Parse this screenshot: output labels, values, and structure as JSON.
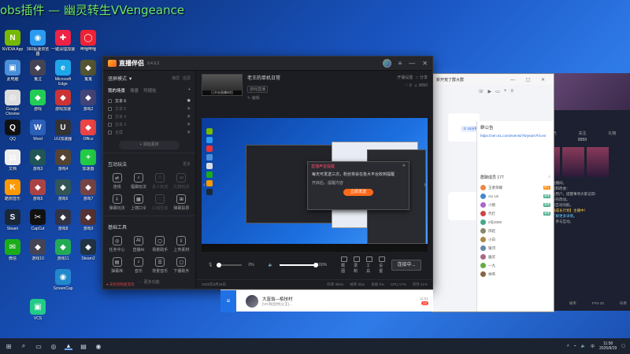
{
  "banner": {
    "text": "obs插件 — 幽灵转生VVengeance"
  },
  "desktop": {
    "icons": [
      {
        "label": "NVIDIA App",
        "color": "#76b900",
        "glyph": "N"
      },
      {
        "label": "360极速浏览器",
        "color": "#2a9bf0",
        "glyph": "◉"
      },
      {
        "label": "一键清理加速",
        "color": "#e24",
        "glyph": "✚"
      },
      {
        "label": "哔哩哔哩",
        "color": "#e23",
        "glyph": "◯"
      },
      {
        "label": "此电脑",
        "color": "#4a8fd9",
        "glyph": "▣"
      },
      {
        "label": "鬼泣",
        "color": "#445",
        "glyph": "◆"
      },
      {
        "label": "Microsoft Edge",
        "color": "#1ea7e8",
        "glyph": "e"
      },
      {
        "label": "鬼鬼",
        "color": "#553",
        "glyph": "◆"
      },
      {
        "label": "Google Chrome",
        "color": "#ddd",
        "glyph": "◎"
      },
      {
        "label": "游戏",
        "color": "#2c5",
        "glyph": "◆"
      },
      {
        "label": "游戏加速",
        "color": "#c33",
        "glyph": "◆"
      },
      {
        "label": "游戏2",
        "color": "#447",
        "glyph": "◆"
      },
      {
        "label": "QQ",
        "color": "#111",
        "glyph": "Q"
      },
      {
        "label": "Word",
        "color": "#2b5fb8",
        "glyph": "W"
      },
      {
        "label": "UU加速器",
        "color": "#333",
        "glyph": "U"
      },
      {
        "label": "Office",
        "color": "#e44",
        "glyph": "◆"
      },
      {
        "label": "文档",
        "color": "#eee",
        "glyph": "▤"
      },
      {
        "label": "游戏3",
        "color": "#255",
        "glyph": "◆"
      },
      {
        "label": "游戏4",
        "color": "#543",
        "glyph": "◆"
      },
      {
        "label": "加速器",
        "color": "#2c4",
        "glyph": "+"
      },
      {
        "label": "酷狗音乐",
        "color": "#f90",
        "glyph": "K"
      },
      {
        "label": "游戏5",
        "color": "#a44",
        "glyph": "◆"
      },
      {
        "label": "游戏6",
        "color": "#355",
        "glyph": "◆"
      },
      {
        "label": "游戏7",
        "color": "#744",
        "glyph": "◆"
      },
      {
        "label": "Steam",
        "color": "#1b2838",
        "glyph": "S"
      },
      {
        "label": "CapCut",
        "color": "#111",
        "glyph": "✂"
      },
      {
        "label": "游戏8",
        "color": "#334",
        "glyph": "◆"
      },
      {
        "label": "游戏9",
        "color": "#533",
        "glyph": "◆"
      },
      {
        "label": "微信",
        "color": "#1aad19",
        "glyph": "✉"
      },
      {
        "label": "游戏10",
        "color": "#445",
        "glyph": "◆"
      },
      {
        "label": "游戏11",
        "color": "#2a5",
        "glyph": "◆"
      },
      {
        "label": "Steam2",
        "color": "#234",
        "glyph": "◆"
      },
      {
        "label": "",
        "color": "",
        "glyph": ""
      },
      {
        "label": "",
        "color": "",
        "glyph": ""
      },
      {
        "label": "ScreenCap",
        "color": "#28c",
        "glyph": "◉"
      },
      {
        "label": "",
        "color": "",
        "glyph": ""
      },
      {
        "label": "",
        "color": "",
        "glyph": ""
      },
      {
        "label": "VCS",
        "color": "#2c8",
        "glyph": "▣"
      }
    ]
  },
  "app": {
    "name": "直播伴侣",
    "version": "9.4.9.2",
    "left": {
      "mode": "竖屏模式 ▼",
      "mode_tag": "横屏",
      "mode_tag2": "竖屏",
      "scene_title": "我的场景",
      "scene_tab1": "场景",
      "scene_tab2": "可视化",
      "scenes": [
        "文本 6",
        "文本 5",
        "文本 4",
        "文本 3",
        "全屏"
      ],
      "add_source": "+ 添加素材",
      "interact_title": "互动玩法",
      "interact_tag": "更多",
      "interact": [
        {
          "label": "连线",
          "glyph": "⇄",
          "dim": false
        },
        {
          "label": "福袋玩法",
          "glyph": "♪",
          "dim": false
        },
        {
          "label": "多人玩法",
          "glyph": "☺",
          "dim": true
        },
        {
          "label": "礼物玩法",
          "glyph": "✉",
          "dim": true
        },
        {
          "label": "弹幕玩法",
          "glyph": "⇩",
          "dim": false
        },
        {
          "label": "上墙口令",
          "glyph": "▦",
          "dim": false
        },
        {
          "label": "心动互动",
          "glyph": "♡",
          "dim": true
        },
        {
          "label": "弹幕投票",
          "glyph": "⊞",
          "dim": false
        }
      ],
      "tools_title": "基础工具",
      "tools": [
        {
          "label": "任务中心",
          "glyph": "◎",
          "dim": false
        },
        {
          "label": "直播AI",
          "glyph": "AI",
          "dim": false
        },
        {
          "label": "场景助手",
          "glyph": "▢",
          "dim": false
        },
        {
          "label": "上传素材",
          "glyph": "⇩",
          "dim": false
        },
        {
          "label": "弹幕库",
          "glyph": "▤",
          "dim": false
        },
        {
          "label": "音乐",
          "glyph": "♪",
          "dim": false
        },
        {
          "label": "背景音乐",
          "glyph": "☰",
          "dim": false
        },
        {
          "label": "下播助手",
          "glyph": "▢",
          "dim": false
        }
      ],
      "more": "··· 更多功能",
      "status_warn": "● 未检测到麦克风"
    },
    "room": {
      "thumb_caption": "已开启直播伴侣",
      "title": "老王的单机日常",
      "tag": "游戏直播",
      "edit": "✎ 编辑",
      "action1": "开播设置",
      "action2": "☆ 分享",
      "likes": "0",
      "viewers": "9050"
    },
    "popup": {
      "header": "直播声音提醒",
      "text": "每天可发送三次，粉丝将会在各大平台收到提醒",
      "line": "开启后，提醒内容",
      "button": "立即发送"
    },
    "controls": {
      "mic_val": "0%",
      "mic_label": "",
      "spk_val": "100%",
      "spk_label": "扬声器",
      "btns": [
        "截图",
        "录制",
        "工具",
        "设置"
      ],
      "start": "连接中..."
    },
    "status": {
      "date": "2025年8月29日",
      "fps": "帧率 0fps",
      "bitrate": "码率 0kb/s",
      "drop": "丢帧 0%",
      "cpu": "CPU 17%",
      "mem": "内存 41%"
    }
  },
  "chat": {
    "title": "新开荒了群大群",
    "group_pill": "② 25分钟前加入",
    "notice_title": "群公告",
    "notice_link": "https://ven.61.com/events/75/years?hl=en",
    "members_title": "群聊成员 177",
    "members": [
      {
        "name": "王者荣耀",
        "color": "#e84",
        "tag": "群主",
        "tcolor": "#f80"
      },
      {
        "name": "AU Us",
        "color": "#48c",
        "tag": "管理",
        "tcolor": "#4a8"
      },
      {
        "name": "小猪",
        "color": "#a6c",
        "tag": "管理",
        "tcolor": "#4a8"
      },
      {
        "name": "代打",
        "color": "#c44",
        "tag": "管理",
        "tcolor": "#4a8"
      },
      {
        "name": "2号2000",
        "color": "#4a8",
        "tag": "",
        "tcolor": ""
      },
      {
        "name": "风轻",
        "color": "#886",
        "tag": "",
        "tcolor": ""
      },
      {
        "name": "小白",
        "color": "#a84",
        "tag": "",
        "tcolor": ""
      },
      {
        "name": "银河",
        "color": "#68a",
        "tag": "",
        "tcolor": ""
      },
      {
        "name": "幽灵",
        "color": "#a68",
        "tag": "",
        "tcolor": ""
      },
      {
        "name": "一九",
        "color": "#6a4",
        "tag": "",
        "tcolor": ""
      },
      {
        "name": "帅哥",
        "color": "#864",
        "tag": "",
        "tcolor": ""
      }
    ]
  },
  "message": {
    "title": "大富翁—栢技村",
    "subtitle": "[VIC粉丝村(火王)...",
    "time": "11:51",
    "badge": "22"
  },
  "right": {
    "stats": [
      {
        "label": "人气",
        "val": "0"
      },
      {
        "label": "关注",
        "val": "8959"
      },
      {
        "label": "礼物",
        "val": ""
      }
    ],
    "chat": [
      {
        "text": "欢迎来到直播间。",
        "cls": ""
      },
      {
        "text": "新增的功能和改进：",
        "cls": ""
      },
      {
        "text": "提示：所有用户。提醒事项大家记得!",
        "cls": ""
      },
      {
        "text": "最近有很多的改动。",
        "cls": ""
      },
      {
        "text": "新增直播间互动功能。",
        "cls": ""
      },
      {
        "text": "【优质主播成长计划】主播中！",
        "cls": "hl"
      },
      {
        "text": "点击这里了解更多详情。",
        "cls": "lk"
      },
      {
        "text": "欢迎光临，参与互动。",
        "cls": ""
      }
    ],
    "foot": [
      "CPU 17%",
      "帧率",
      "FPS 30",
      "码率"
    ]
  },
  "taskbar": {
    "time": "11:58",
    "date": "2025/8/29",
    "lang": "中"
  }
}
